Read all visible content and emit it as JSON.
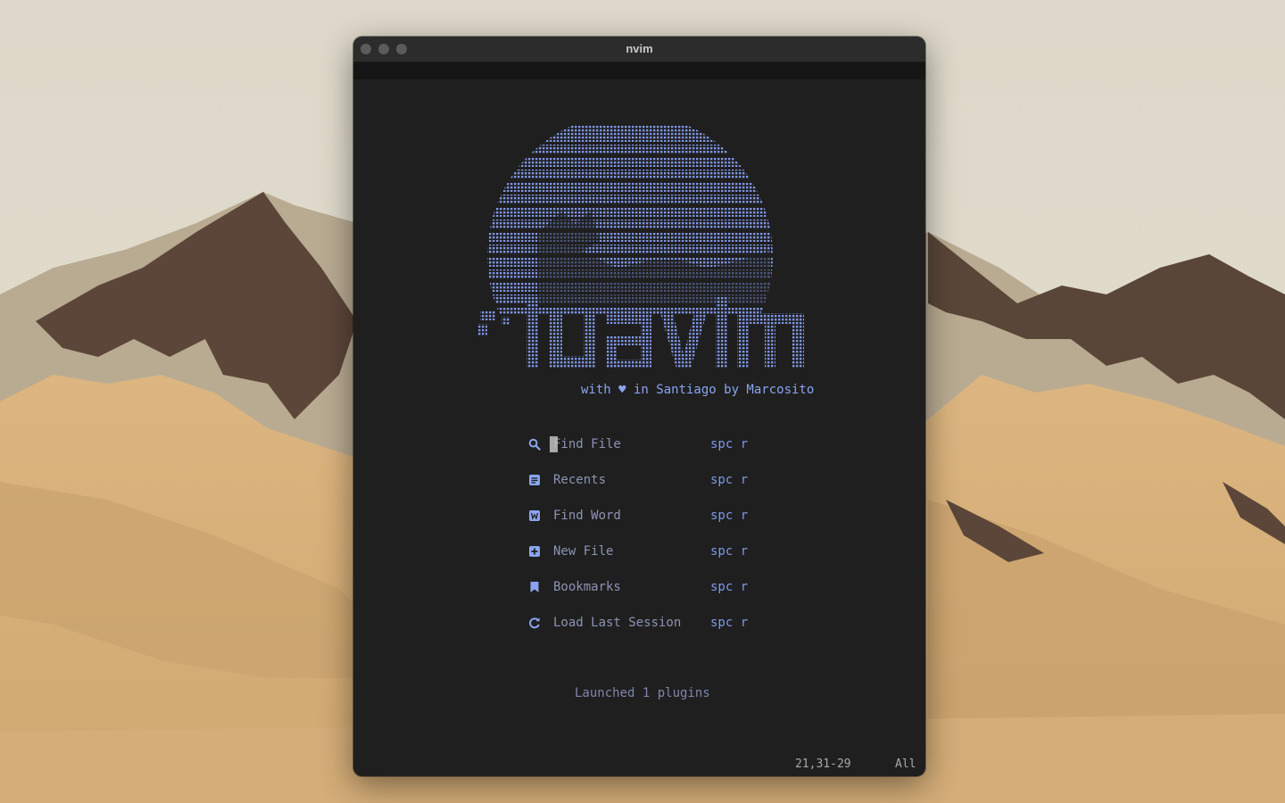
{
  "window": {
    "title": "nvim"
  },
  "logo": {
    "art_label": "luavim"
  },
  "tagline": "with ♥ in Santiago by Marcosito",
  "menu": [
    {
      "icon": "search-icon",
      "label": "Find File",
      "shortcut": "spc r"
    },
    {
      "icon": "recents-icon",
      "label": "Recents",
      "shortcut": "spc r"
    },
    {
      "icon": "find-word-icon",
      "label": "Find Word",
      "shortcut": "spc r"
    },
    {
      "icon": "new-file-icon",
      "label": "New File",
      "shortcut": "spc r"
    },
    {
      "icon": "bookmark-icon",
      "label": "Bookmarks",
      "shortcut": "spc r"
    },
    {
      "icon": "refresh-icon",
      "label": "Load Last Session",
      "shortcut": "spc r"
    }
  ],
  "footer": "Launched 1 plugins",
  "status": {
    "position": "21,31-29",
    "scroll": "All"
  },
  "colors": {
    "accent": "#8aa4f0",
    "menu_text": "#8d93b5",
    "background": "#1f1f1f",
    "desktop_sand": "#d9b27f"
  }
}
